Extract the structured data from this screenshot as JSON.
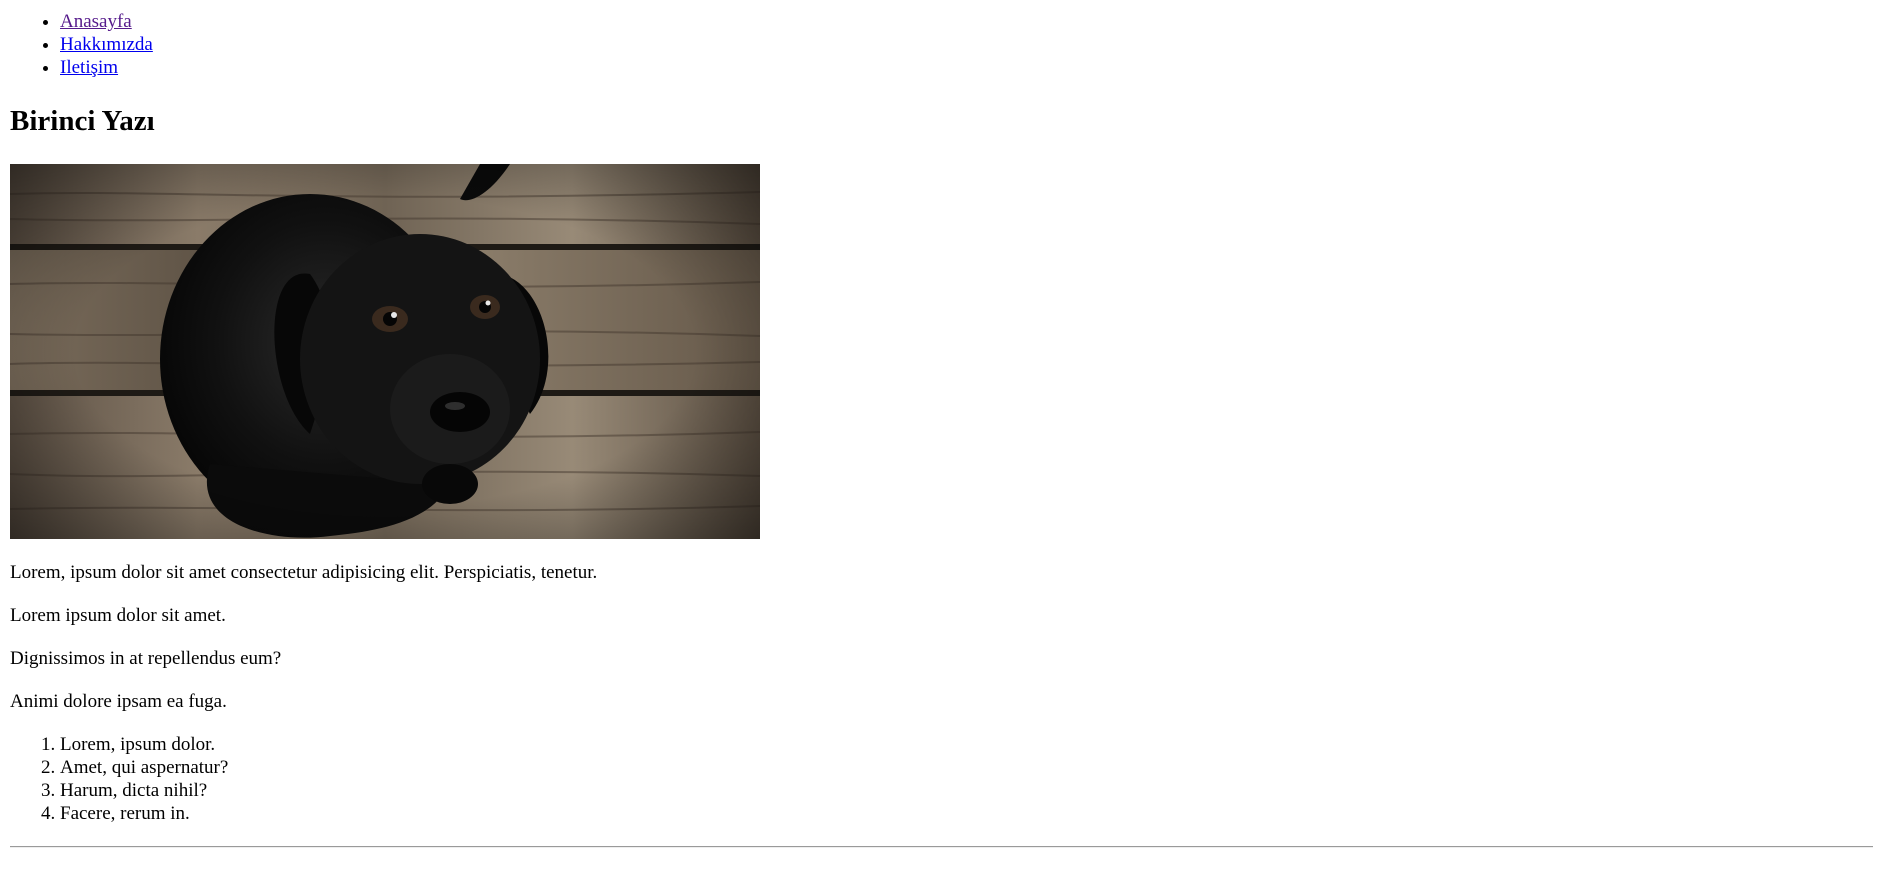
{
  "nav": {
    "items": [
      {
        "label": "Anasayfa"
      },
      {
        "label": "Hakkımızda"
      },
      {
        "label": "Iletişim"
      }
    ]
  },
  "article": {
    "title": "Birinci Yazı",
    "image": {
      "subject": "black puppy on wooden floor"
    },
    "paragraphs": [
      "Lorem, ipsum dolor sit amet consectetur adipisicing elit. Perspiciatis, tenetur.",
      "Lorem ipsum dolor sit amet.",
      "Dignissimos in at repellendus eum?",
      "Animi dolore ipsam ea fuga."
    ],
    "ordered_list": [
      "Lorem, ipsum dolor.",
      "Amet, qui aspernatur?",
      "Harum, dicta nihil?",
      "Facere, rerum in."
    ]
  },
  "colors": {
    "link": "#0000ee",
    "visited_link": "#551a8b",
    "text": "#000000",
    "background": "#ffffff"
  }
}
